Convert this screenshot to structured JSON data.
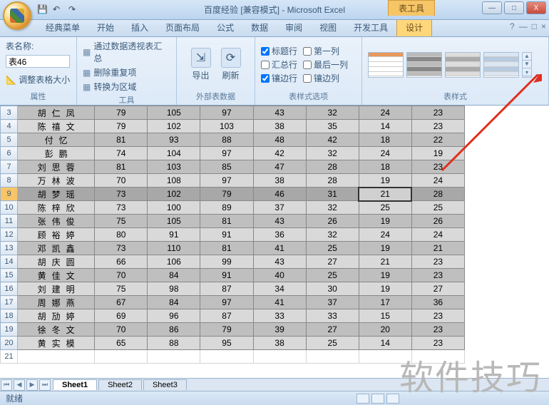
{
  "window": {
    "title": "百度经验  [兼容模式] - Microsoft Excel",
    "context_tab": "表工具",
    "min": "—",
    "max": "□",
    "close": "X"
  },
  "tabs": {
    "items": [
      "经典菜单",
      "开始",
      "插入",
      "页面布局",
      "公式",
      "数据",
      "审阅",
      "视图",
      "开发工具",
      "设计"
    ],
    "active": "设计"
  },
  "ribbon": {
    "prop": {
      "label": "属性",
      "name_label": "表名称:",
      "name_value": "表46",
      "adjust": "调整表格大小"
    },
    "tools": {
      "label": "工具",
      "items": [
        "通过数据透视表汇总",
        "删除重复项",
        "转换为区域"
      ]
    },
    "ext": {
      "label": "外部表数据",
      "export": "导出",
      "refresh": "刷新"
    },
    "styleopt": {
      "label": "表样式选项",
      "items": [
        {
          "label": "标题行",
          "checked": true
        },
        {
          "label": "第一列",
          "checked": false
        },
        {
          "label": "汇总行",
          "checked": false
        },
        {
          "label": "最后一列",
          "checked": false
        },
        {
          "label": "镶边行",
          "checked": true
        },
        {
          "label": "镶边列",
          "checked": false
        }
      ]
    },
    "styles": {
      "label": "表样式"
    }
  },
  "table": {
    "rows": [
      {
        "n": 3,
        "name": "胡仁凤",
        "v": [
          79,
          105,
          97,
          43,
          32,
          24,
          23
        ],
        "odd": true
      },
      {
        "n": 4,
        "name": "陈禧文",
        "v": [
          79,
          102,
          103,
          38,
          35,
          14,
          23
        ],
        "odd": false
      },
      {
        "n": 5,
        "name": "付忆",
        "v": [
          81,
          93,
          88,
          48,
          42,
          18,
          22
        ],
        "odd": true
      },
      {
        "n": 6,
        "name": "彭鹏",
        "v": [
          74,
          104,
          97,
          42,
          32,
          24,
          19
        ],
        "odd": false
      },
      {
        "n": 7,
        "name": "刘思蓉",
        "v": [
          81,
          103,
          85,
          47,
          28,
          18,
          23
        ],
        "odd": true
      },
      {
        "n": 8,
        "name": "万林波",
        "v": [
          70,
          108,
          97,
          38,
          28,
          19,
          24
        ],
        "odd": false
      },
      {
        "n": 9,
        "name": "胡梦瑶",
        "v": [
          73,
          102,
          79,
          46,
          31,
          21,
          28
        ],
        "odd": true,
        "sel": true,
        "hl": 5
      },
      {
        "n": 10,
        "name": "陈梓欣",
        "v": [
          73,
          100,
          89,
          37,
          32,
          25,
          25
        ],
        "odd": false
      },
      {
        "n": 11,
        "name": "张伟俊",
        "v": [
          75,
          105,
          81,
          43,
          26,
          19,
          26
        ],
        "odd": true
      },
      {
        "n": 12,
        "name": "顾裕婷",
        "v": [
          80,
          91,
          91,
          36,
          32,
          24,
          24
        ],
        "odd": false
      },
      {
        "n": 13,
        "name": "邓凯鑫",
        "v": [
          73,
          110,
          81,
          41,
          25,
          19,
          21
        ],
        "odd": true
      },
      {
        "n": 14,
        "name": "胡庆圆",
        "v": [
          66,
          106,
          99,
          43,
          27,
          21,
          23
        ],
        "odd": false
      },
      {
        "n": 15,
        "name": "黄佳文",
        "v": [
          70,
          84,
          91,
          40,
          25,
          19,
          23
        ],
        "odd": true
      },
      {
        "n": 16,
        "name": "刘建明",
        "v": [
          75,
          98,
          87,
          34,
          30,
          19,
          27
        ],
        "odd": false
      },
      {
        "n": 17,
        "name": "周娜燕",
        "v": [
          67,
          84,
          97,
          41,
          37,
          17,
          36
        ],
        "odd": true
      },
      {
        "n": 18,
        "name": "胡劢婷",
        "v": [
          69,
          96,
          87,
          33,
          33,
          15,
          23
        ],
        "odd": false
      },
      {
        "n": 19,
        "name": "徐冬文",
        "v": [
          70,
          86,
          79,
          39,
          27,
          20,
          23
        ],
        "odd": true
      },
      {
        "n": 20,
        "name": "黄实模",
        "v": [
          65,
          88,
          95,
          38,
          25,
          14,
          23
        ],
        "odd": false
      }
    ],
    "empty_row": 21
  },
  "sheets": {
    "items": [
      "Sheet1",
      "Sheet2",
      "Sheet3"
    ],
    "active": "Sheet1"
  },
  "status": {
    "ready": "就绪"
  },
  "watermark": "软件技巧"
}
